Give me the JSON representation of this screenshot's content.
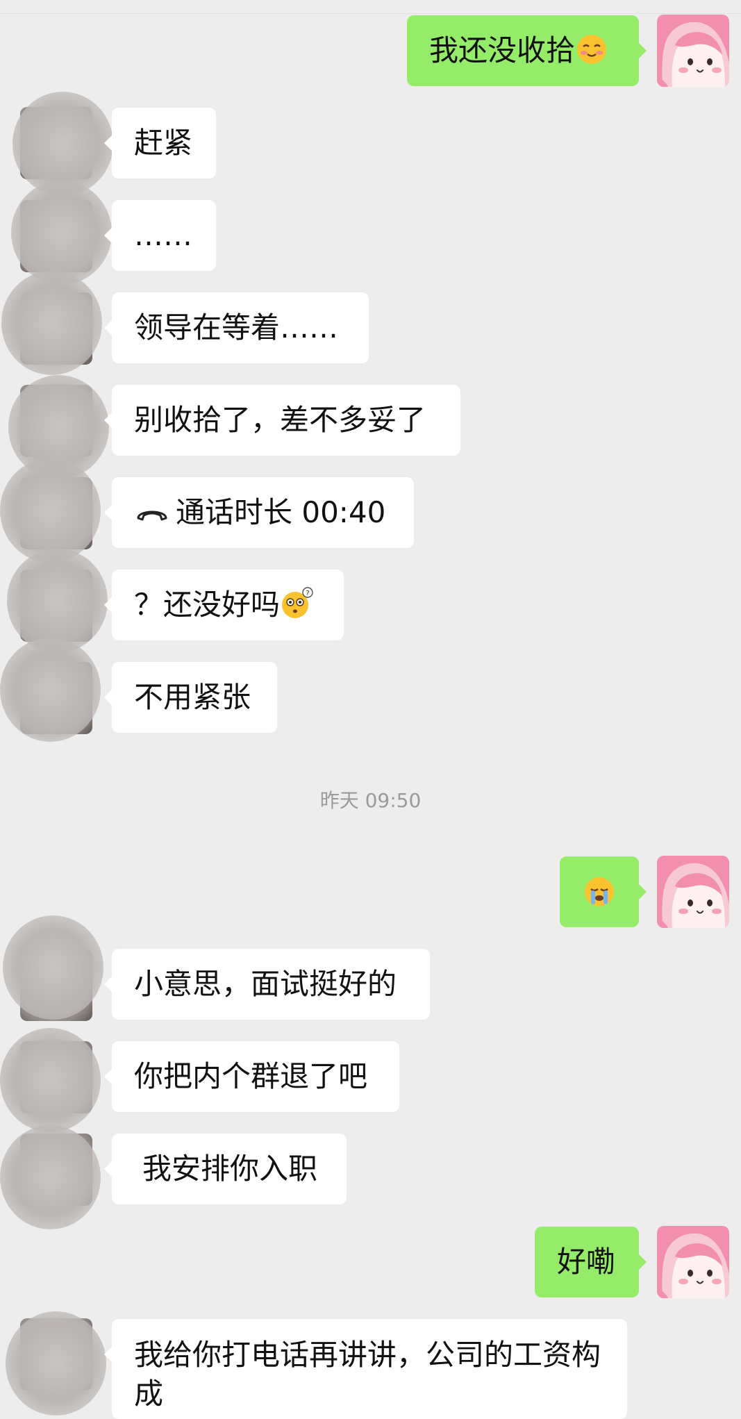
{
  "messages": {
    "m1": "我还没收拾",
    "m2": "赶紧",
    "m3": "……",
    "m4": "领导在等着……",
    "m5": "别收拾了，差不多妥了",
    "m6": "通话时长 00:40",
    "m7": "？还没好吗",
    "m8": "不用紧张",
    "m10": "小意思，面试挺好的",
    "m11": "你把内个群退了吧",
    "m12": "我安排你入职",
    "m13": "好嘞",
    "m14": "我给你打电话再讲讲，公司的工资构成"
  },
  "timestamp": "昨天 09:50",
  "icons": {
    "m1": "smiling-blush-emoji",
    "m6": "phone-hangup-icon",
    "m7": "confused-face-emoji",
    "m9": "crying-face-emoji"
  },
  "colors": {
    "background": "#ededed",
    "sent_bubble": "#95ec69",
    "received_bubble": "#ffffff",
    "timestamp_text": "#9a9a9a"
  }
}
